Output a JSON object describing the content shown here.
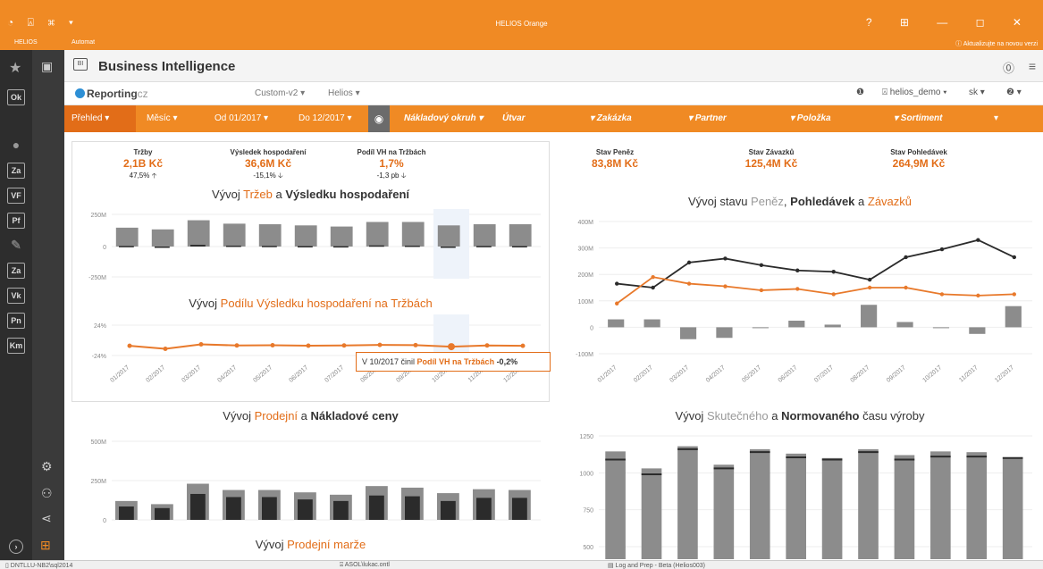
{
  "window": {
    "title": "HELIOS Orange",
    "app_label": "HELIOS",
    "automat": "Automat",
    "update_notice": "ⓘ Aktualizujte na novou verzi",
    "left_icons": "◔ ⍓ ⌘ ▾",
    "controls": "? ⊞ — ◻ ✕"
  },
  "sidebar": {
    "items": [
      "Ok",
      "Za",
      "VF",
      "Pf",
      "Za",
      "Vk",
      "Pn",
      "Km"
    ]
  },
  "header": {
    "title": "Business Intelligence",
    "icon_text": "BI"
  },
  "reporting": {
    "logo": "Reporting",
    "logo_suffix": "cz",
    "dropdown1": "Custom-v2 ▾",
    "dropdown2": "Helios ▾",
    "info": "❶",
    "user": "helios_demo ▾",
    "lang": "sk ▾",
    "help": "❷ ▾"
  },
  "filters": {
    "prehled": "Přehled ▾",
    "mesic": "Měsíc ▾",
    "od": "Od 01/2017 ▾",
    "do": "Do 12/2017 ▾",
    "eye": "◉",
    "naklady": "Nákladový okruh ▾",
    "utvar": "Útvar",
    "zakazka": "▾ Zakázka",
    "partner": "▾ Partner",
    "polozka": "▾ Položka",
    "sortiment": "▾ Sortiment",
    "last": "▾"
  },
  "kpis_left": [
    {
      "label": "Tržby",
      "value": "2,1B Kč",
      "change": "47,5% 🡡"
    },
    {
      "label": "Výsledek hospodaření",
      "value": "36,6M Kč",
      "change": "-15,1% 🡣"
    },
    {
      "label": "Podíl VH na Tržbách",
      "value": "1,7%",
      "change": "-1,3 pb 🡣"
    }
  ],
  "kpis_right": [
    {
      "label": "Stav Peněz",
      "value": "83,8M Kč"
    },
    {
      "label": "Stav Závazků",
      "value": "125,4M Kč"
    },
    {
      "label": "Stav Pohledávek",
      "value": "264,9M Kč"
    }
  ],
  "titles": {
    "c1_a": "Vývoj ",
    "c1_b": "Tržeb",
    "c1_c": " a ",
    "c1_d": "Výsledku hospodaření",
    "c2_a": "Vývoj ",
    "c2_b": "Podílu Výsledku hospodaření na Tržbách",
    "c3_a": "Vývoj stavu ",
    "c3_b": "Peněz",
    "c3_c": ", ",
    "c3_d": "Pohledávek",
    "c3_e": " a ",
    "c3_f": "Závazků",
    "c4_a": "Vývoj ",
    "c4_b": "Prodejní",
    "c4_c": " a ",
    "c4_d": "Nákladové ceny",
    "c5_a": "Vývoj ",
    "c5_b": "Skutečného",
    "c5_c": " a ",
    "c5_d": "Normovaného",
    "c5_e": " času výroby",
    "c6_a": "Vývoj ",
    "c6_b": "Prodejní marže"
  },
  "tooltip": {
    "a": "V 10/2017 činil ",
    "b": "Podíl VH na Tržbách",
    "c": " -0,2%"
  },
  "status": {
    "s1": "▯ DNTLLU-NB2\\sql2014",
    "s2": "⍓ ASOL\\lukac.ontl",
    "s3": "▤ Log and Prep - Beta (Helios003)"
  },
  "chart_data": [
    {
      "type": "bar",
      "id": "trzby_vh",
      "categories": [
        "01/2017",
        "02/2017",
        "03/2017",
        "04/2017",
        "05/2017",
        "06/2017",
        "07/2017",
        "08/2017",
        "09/2017",
        "10/2017",
        "11/2017",
        "12/2017"
      ],
      "yticks": [
        "250M",
        "0",
        "-250M"
      ],
      "ylim": [
        -250,
        250
      ],
      "series": [
        {
          "name": "Tržby",
          "values": [
            165,
            150,
            230,
            200,
            195,
            185,
            175,
            215,
            215,
            185,
            195,
            195
          ]
        },
        {
          "name": "Výsledek hospodaření",
          "values": [
            5,
            -10,
            15,
            8,
            6,
            4,
            3,
            10,
            8,
            -1,
            5,
            4
          ]
        }
      ]
    },
    {
      "type": "line",
      "id": "podil_vh",
      "categories": [
        "01/2017",
        "02/2017",
        "03/2017",
        "04/2017",
        "05/2017",
        "06/2017",
        "07/2017",
        "08/2017",
        "09/2017",
        "10/2017",
        "11/2017",
        "12/2017"
      ],
      "yticks": [
        "24%",
        "-24%"
      ],
      "ylim": [
        -24,
        24
      ],
      "series": [
        {
          "name": "Podíl VH na Tržbách",
          "values": [
            2,
            -6,
            6,
            3,
            3.5,
            2.5,
            3,
            4.5,
            4,
            -0.2,
            3,
            2
          ]
        }
      ]
    },
    {
      "type": "line",
      "id": "stav",
      "categories": [
        "01/2017",
        "02/2017",
        "03/2017",
        "04/2017",
        "05/2017",
        "06/2017",
        "07/2017",
        "08/2017",
        "09/2017",
        "10/2017",
        "11/2017",
        "12/2017"
      ],
      "yticks": [
        "400M",
        "300M",
        "200M",
        "100M",
        "0",
        "-100M"
      ],
      "ylim": [
        -100,
        400
      ],
      "series": [
        {
          "name": "Peněz",
          "type": "bar",
          "values": [
            30,
            30,
            -45,
            -40,
            0,
            25,
            10,
            85,
            20,
            0,
            -25,
            80
          ]
        },
        {
          "name": "Pohledávek",
          "values": [
            165,
            150,
            245,
            260,
            235,
            215,
            210,
            180,
            265,
            295,
            330,
            265
          ]
        },
        {
          "name": "Závazků",
          "values": [
            90,
            190,
            165,
            155,
            140,
            145,
            125,
            150,
            150,
            125,
            120,
            125
          ]
        }
      ]
    },
    {
      "type": "bar",
      "id": "ceny",
      "yticks": [
        "500M",
        "250M",
        "0"
      ],
      "ylim": [
        0,
        500
      ],
      "series": [
        {
          "name": "Prodejní",
          "values": [
            120,
            100,
            230,
            190,
            190,
            175,
            160,
            215,
            205,
            170,
            195,
            190
          ]
        },
        {
          "name": "Nákladová",
          "values": [
            85,
            75,
            165,
            145,
            145,
            130,
            120,
            155,
            150,
            120,
            140,
            140
          ]
        }
      ]
    },
    {
      "type": "bar",
      "id": "cas",
      "yticks": [
        "1250",
        "1000",
        "750",
        "500"
      ],
      "ylim": [
        500,
        1250
      ],
      "series": [
        {
          "name": "Skutečného",
          "values": [
            1145,
            1030,
            1180,
            1055,
            1160,
            1130,
            1100,
            1160,
            1120,
            1145,
            1140,
            1105
          ]
        },
        {
          "name": "Normovaného",
          "values": [
            1090,
            990,
            1160,
            1030,
            1140,
            1105,
            1090,
            1140,
            1090,
            1110,
            1110,
            1100
          ]
        }
      ]
    }
  ]
}
